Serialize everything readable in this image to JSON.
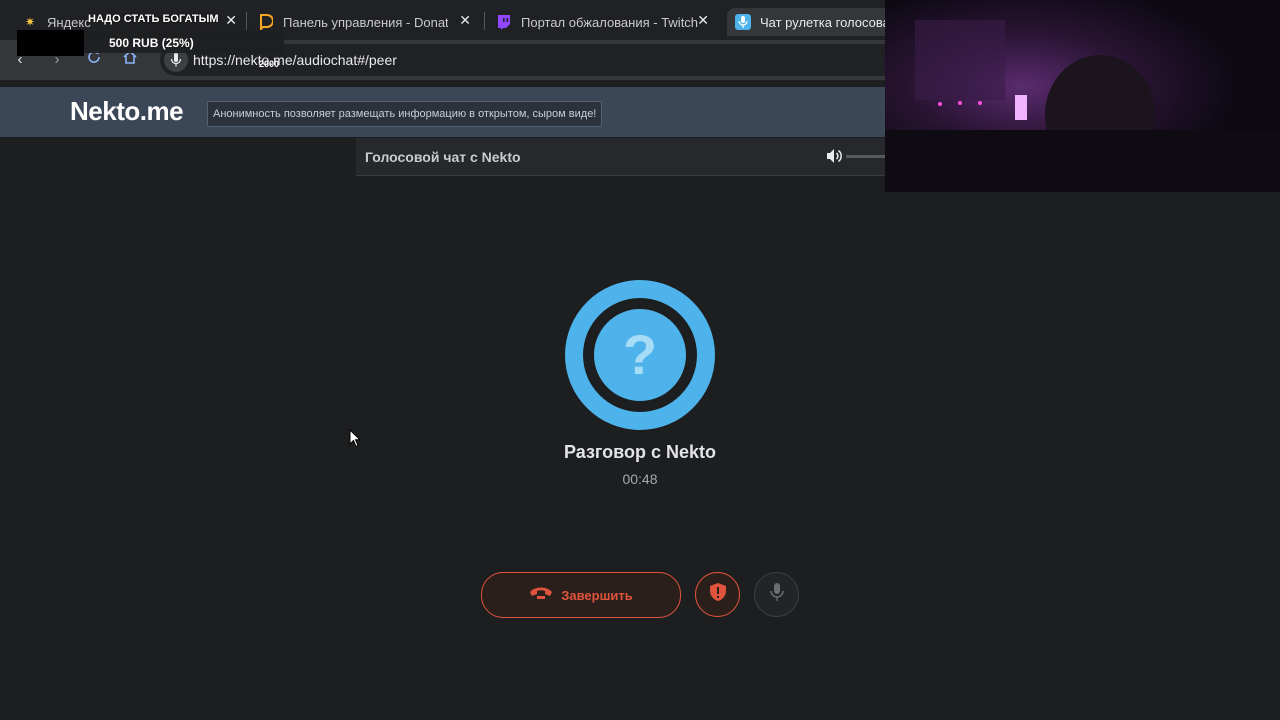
{
  "browser": {
    "tabs": [
      {
        "title": "Яндекс",
        "favicon": "sun-icon",
        "active": false
      },
      {
        "title": "Панель управления - Donatio",
        "favicon": "donationalerts-icon",
        "active": false
      },
      {
        "title": "Портал обжалования - Twitch",
        "favicon": "twitch-icon",
        "active": false
      },
      {
        "title": "Чат рулетка голосовая",
        "favicon": "mic-icon",
        "active": true
      }
    ],
    "url": "https://nekto.me/audiochat#/peer"
  },
  "stream_overlay": {
    "goal_title": "НАДО СТАТЬ БОГАТЫМ",
    "goal_amount": "500 RUB (25%)",
    "goal_percent": 25,
    "goal_target_small": "2000"
  },
  "site": {
    "logo": "Nekto.me",
    "slogan": "Анонимность позволяет размещать информацию в открытом, сыром виде!"
  },
  "chat_header": {
    "title": "Голосовой чат с Nekto"
  },
  "conversation": {
    "avatar_symbol": "?",
    "title": "Разговор с Nekto",
    "timer": "00:48"
  },
  "controls": {
    "end_label": "Завершить"
  },
  "colors": {
    "accent_blue": "#4db3ea",
    "end_red": "#e0533d",
    "header_bg": "#3b4656",
    "page_bg": "#1d1e20"
  }
}
